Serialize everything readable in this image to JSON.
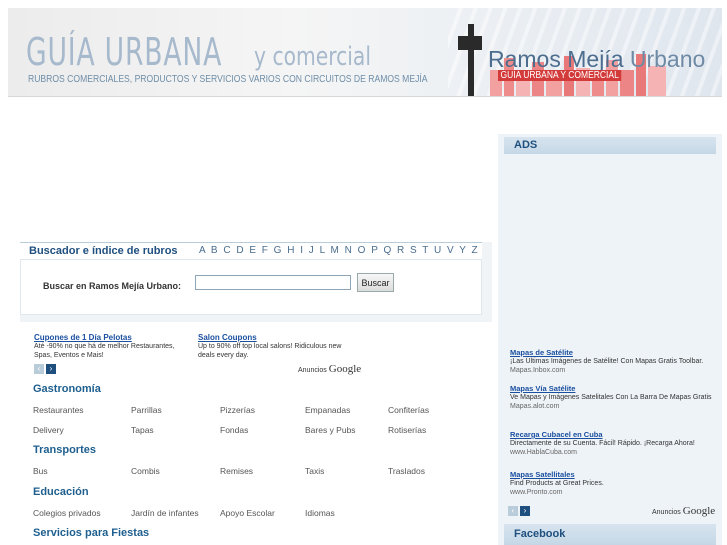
{
  "header": {
    "title_main": "GUÍA URBANA",
    "title_small": "y comercial",
    "tagline": "RUBROS COMERCIALES, PRODUCTOS Y SERVICIOS VARIOS CON CIRCUITOS DE RAMOS MEJÍA",
    "brand_left": "Ramos Mejía",
    "brand_right": "Urbano",
    "brand_sub": "GUÍA URBANA Y COMERCIAL"
  },
  "sidebar": {
    "ads_title": "ADS",
    "facebook_title": "Facebook",
    "ads": [
      {
        "title": "Mapas de Satélite",
        "text": "¡Las Últimas Imágenes de Satélite! Con Mapas Gratis Toolbar.",
        "url": "Mapas.Inbox.com"
      },
      {
        "title": "Mapas Vía Satélite",
        "text": "Ve Mapas y Imágenes Satelitales Con La Barra De Mapas Gratis",
        "url": "Mapas.alot.com"
      },
      {
        "title": "Recarga Cubacel en Cuba",
        "text": "Directamente de su Cuenta. Fácil! Rápido. ¡Recarga Ahora!",
        "url": "www.HablaCuba.com"
      },
      {
        "title": "Mapas Satellitales",
        "text": "Find Products at Great Prices.",
        "url": "www.Pronto.com"
      }
    ],
    "anuncios": "Anuncios",
    "google": "Google"
  },
  "search": {
    "header_label": "Buscador e índice de rubros",
    "alphabet": "A B C D E F G H I J L M N O P Q R S T U V Y Z",
    "field_label": "Buscar en Ramos Mejía Urbano:",
    "input_value": "",
    "button_label": "Buscar"
  },
  "inline_ads": [
    {
      "title": "Cupones de 1 Día Pelotas",
      "text": "Até -90% no que há de melhor Restaurantes, Spas, Eventos e Mais!"
    },
    {
      "title": "Salon Coupons",
      "text": "Up to 90% off top local salons! Ridiculous new deals every day."
    }
  ],
  "inline_anuncios": "Anuncios",
  "inline_google": "Google",
  "categories": [
    {
      "heading": "Gastronomía",
      "items": [
        "Restaurantes",
        "Parrillas",
        "Pizzerías",
        "Empanadas",
        "Confiterías",
        "Delivery",
        "Tapas",
        "Fondas",
        "Bares y Pubs",
        "Rotiserías"
      ]
    },
    {
      "heading": "Transportes",
      "items": [
        "Bus",
        "Combis",
        "Remises",
        "Taxis",
        "Traslados"
      ]
    },
    {
      "heading": "Educación",
      "items": [
        "Colegios privados",
        "Jardín de infantes",
        "Apoyo Escolar",
        "Idiomas"
      ]
    },
    {
      "heading": "Servicios para Fiestas",
      "items": []
    }
  ],
  "colors": {
    "accent": "#1e4f7e",
    "link": "#1a4fa0",
    "heading": "#1e5f8f"
  }
}
